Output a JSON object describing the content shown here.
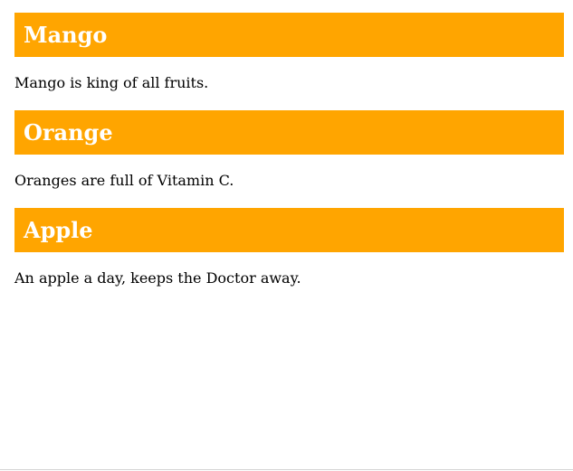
{
  "colors": {
    "heading_background": "#ffa500",
    "heading_text": "#ffffff",
    "body_text": "#000000",
    "page_background": "#ffffff"
  },
  "sections": [
    {
      "heading": "Mango",
      "text": "Mango is king of all fruits."
    },
    {
      "heading": "Orange",
      "text": "Oranges are full of Vitamin C."
    },
    {
      "heading": "Apple",
      "text": "An apple a day, keeps the Doctor away."
    }
  ]
}
